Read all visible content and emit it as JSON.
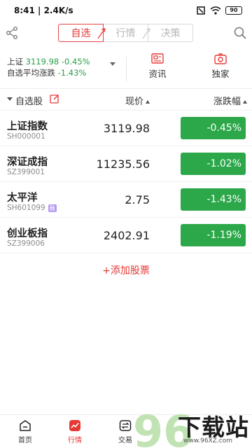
{
  "status_bar": {
    "time_speed": "8:41 | 2.4K/s",
    "battery": "90"
  },
  "header": {
    "tabs": [
      {
        "label": "自选",
        "active": true
      },
      {
        "label": "行情",
        "active": false
      },
      {
        "label": "决策",
        "active": false
      }
    ],
    "icons": {
      "left": "share-icon",
      "right": "search-icon"
    }
  },
  "summary": {
    "index_name": "上证",
    "index_value": "3119.98",
    "index_change": "-0.45%",
    "avg_label": "自选平均涨跌",
    "avg_change": "-1.43%",
    "news_label": "资讯",
    "exclusive_label": "独家"
  },
  "columns": {
    "watchlist": "自选股",
    "price": "现价",
    "change": "涨跌幅"
  },
  "stocks": [
    {
      "name": "上证指数",
      "code": "SH000001",
      "price": "3119.98",
      "change": "-0.45%"
    },
    {
      "name": "深证成指",
      "code": "SZ399001",
      "price": "11235.56",
      "change": "-1.02%"
    },
    {
      "name": "太平洋",
      "code": "SH601099",
      "price": "2.75",
      "change": "-1.43%",
      "badge": "融"
    },
    {
      "name": "创业板指",
      "code": "SZ399006",
      "price": "2402.91",
      "change": "-1.19%"
    }
  ],
  "add_stock": "+添加股票",
  "bottom_nav": [
    {
      "label": "首页",
      "icon": "home-icon"
    },
    {
      "label": "行情",
      "icon": "market-chart-icon",
      "active": true
    },
    {
      "label": "交易",
      "icon": "trade-icon"
    }
  ],
  "watermark": {
    "text": "下载站",
    "url": "www.96XZ.com"
  },
  "colors": {
    "accent": "#e53935",
    "down": "#2ca84a"
  }
}
